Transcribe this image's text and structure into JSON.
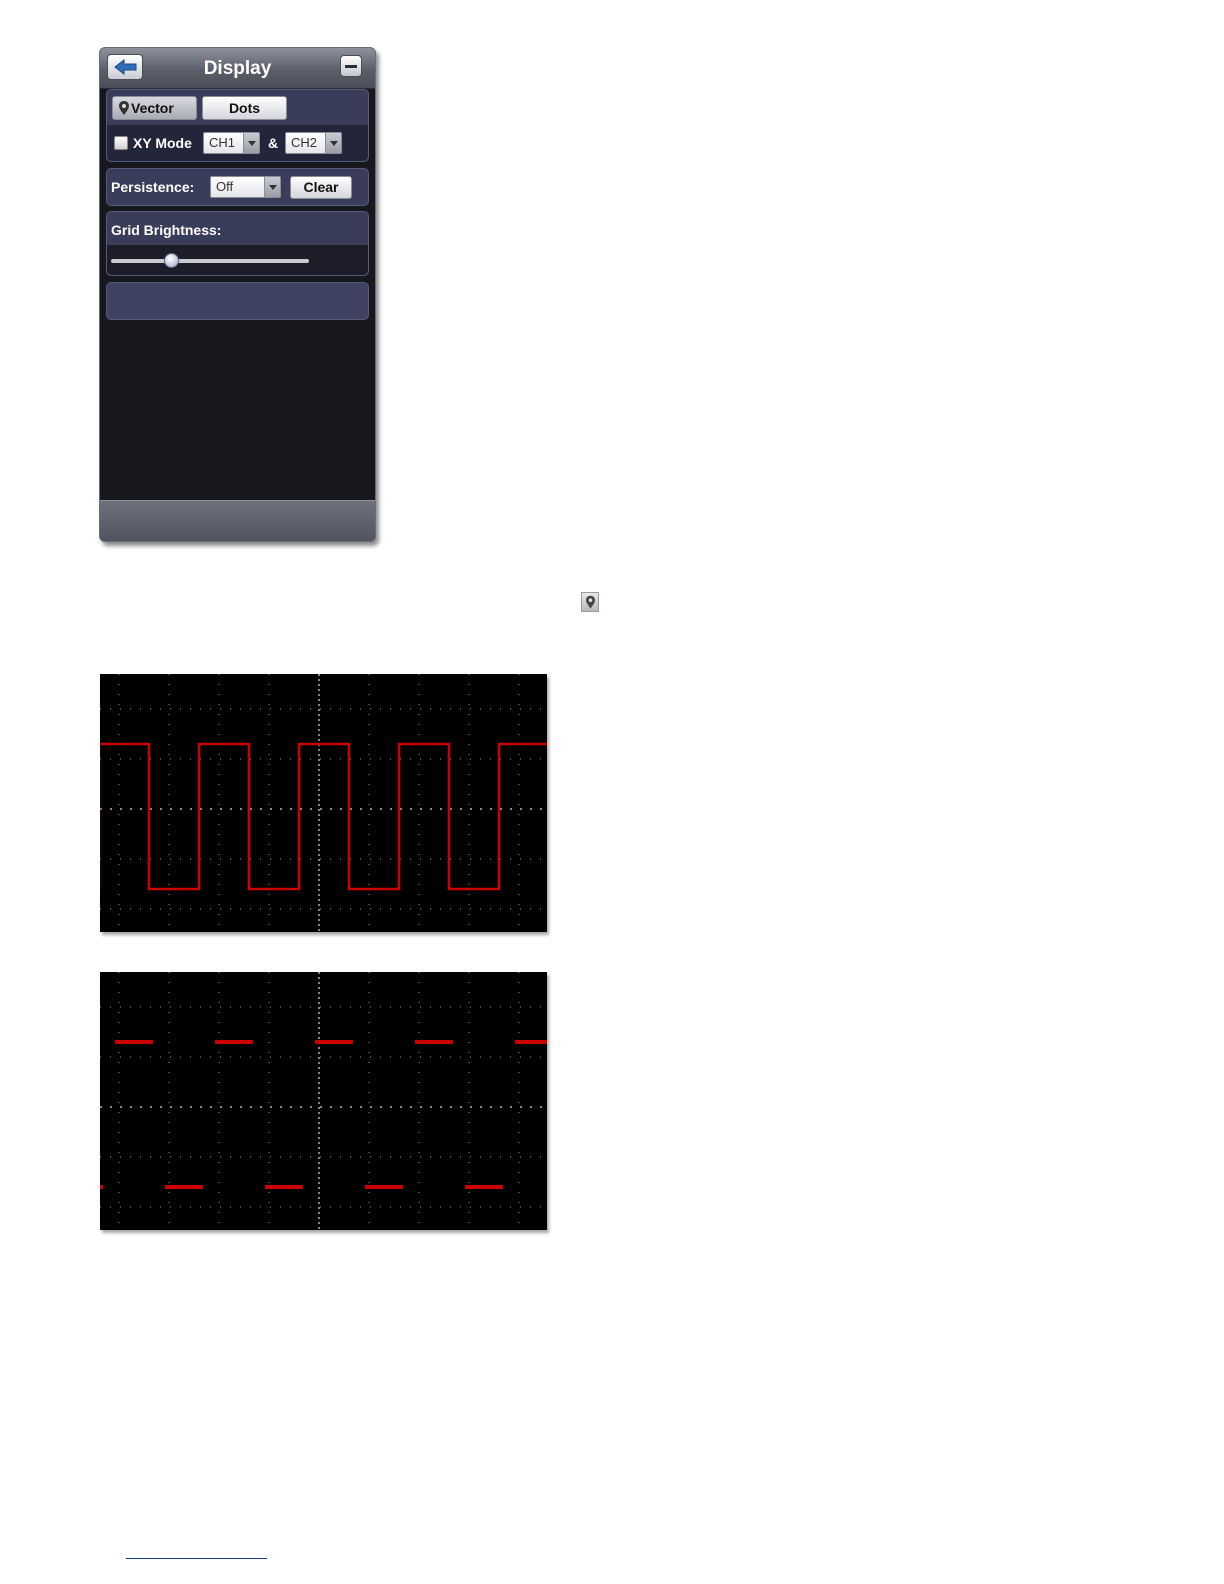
{
  "panel": {
    "title": "Display",
    "back_icon": "arrow-left-icon",
    "minimize_icon": "minus-icon",
    "display_type": {
      "options": [
        "Vector",
        "Dots"
      ],
      "selected": "Vector",
      "vector_label": "Vector",
      "dots_label": "Dots",
      "selected_icon": "map-pin-icon"
    },
    "xy_mode": {
      "label": "XY Mode",
      "checked": false,
      "channel_a": "CH1",
      "separator": "&",
      "channel_b": "CH2"
    },
    "persistence": {
      "label": "Persistence:",
      "value": "Off",
      "clear_label": "Clear"
    },
    "grid_brightness": {
      "label": "Grid Brightness:",
      "level": 0.3
    }
  },
  "inline_icon": "map-pin-icon",
  "colors": {
    "trace": "#cc0000",
    "scope_background": "#000000",
    "grid": "#9a9a9a",
    "panel_section": "#3a3d5a"
  },
  "scopes": [
    {
      "mode": "Vector",
      "waveform": "square",
      "high_division": 1.3,
      "low_division": -1.6,
      "first_rise_division": -4.4,
      "period_divisions": 2,
      "duty": 0.5
    },
    {
      "mode": "Dots",
      "waveform": "square",
      "high_division": 1.3,
      "low_division": -1.6,
      "first_rise_division": -4.2,
      "period_divisions": 2,
      "duty": 0.5
    }
  ]
}
